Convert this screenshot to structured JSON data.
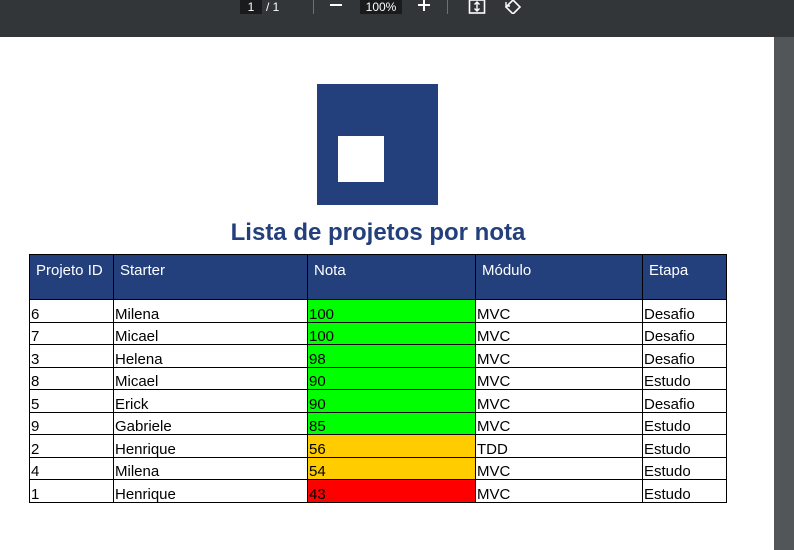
{
  "toolbar": {
    "page_current": "1",
    "page_total": "/ 1",
    "zoom": "100%",
    "zoom_out_icon": "minus-icon",
    "zoom_in_icon": "plus-icon",
    "fit_page_icon": "fit-to-page-icon",
    "rotate_icon": "rotate-icon"
  },
  "document": {
    "title": "Lista de projetos por nota",
    "brand_color": "#23407d",
    "table": {
      "headers": [
        "Projeto ID",
        "Starter",
        "Nota",
        "Módulo",
        "Etapa"
      ],
      "rows": [
        {
          "id": "6",
          "starter": "Milena",
          "nota": "100",
          "modulo": "MVC",
          "etapa": "Desafio",
          "nota_color": "#00ff00"
        },
        {
          "id": "7",
          "starter": "Micael",
          "nota": "100",
          "modulo": "MVC",
          "etapa": "Desafio",
          "nota_color": "#00ff00"
        },
        {
          "id": "3",
          "starter": "Helena",
          "nota": "98",
          "modulo": "MVC",
          "etapa": "Desafio",
          "nota_color": "#00ff00"
        },
        {
          "id": "8",
          "starter": "Micael",
          "nota": "90",
          "modulo": "MVC",
          "etapa": "Estudo",
          "nota_color": "#00ff00"
        },
        {
          "id": "5",
          "starter": "Erick",
          "nota": "90",
          "modulo": "MVC",
          "etapa": "Desafio",
          "nota_color": "#00ff00"
        },
        {
          "id": "9",
          "starter": "Gabriele",
          "nota": "85",
          "modulo": "MVC",
          "etapa": "Estudo",
          "nota_color": "#00ff00"
        },
        {
          "id": "2",
          "starter": "Henrique",
          "nota": "56",
          "modulo": "TDD",
          "etapa": "Estudo",
          "nota_color": "#ffcc00"
        },
        {
          "id": "4",
          "starter": "Milena",
          "nota": "54",
          "modulo": "MVC",
          "etapa": "Estudo",
          "nota_color": "#ffcc00"
        },
        {
          "id": "1",
          "starter": "Henrique",
          "nota": "43",
          "modulo": "MVC",
          "etapa": "Estudo",
          "nota_color": "#ff0000"
        }
      ]
    }
  }
}
